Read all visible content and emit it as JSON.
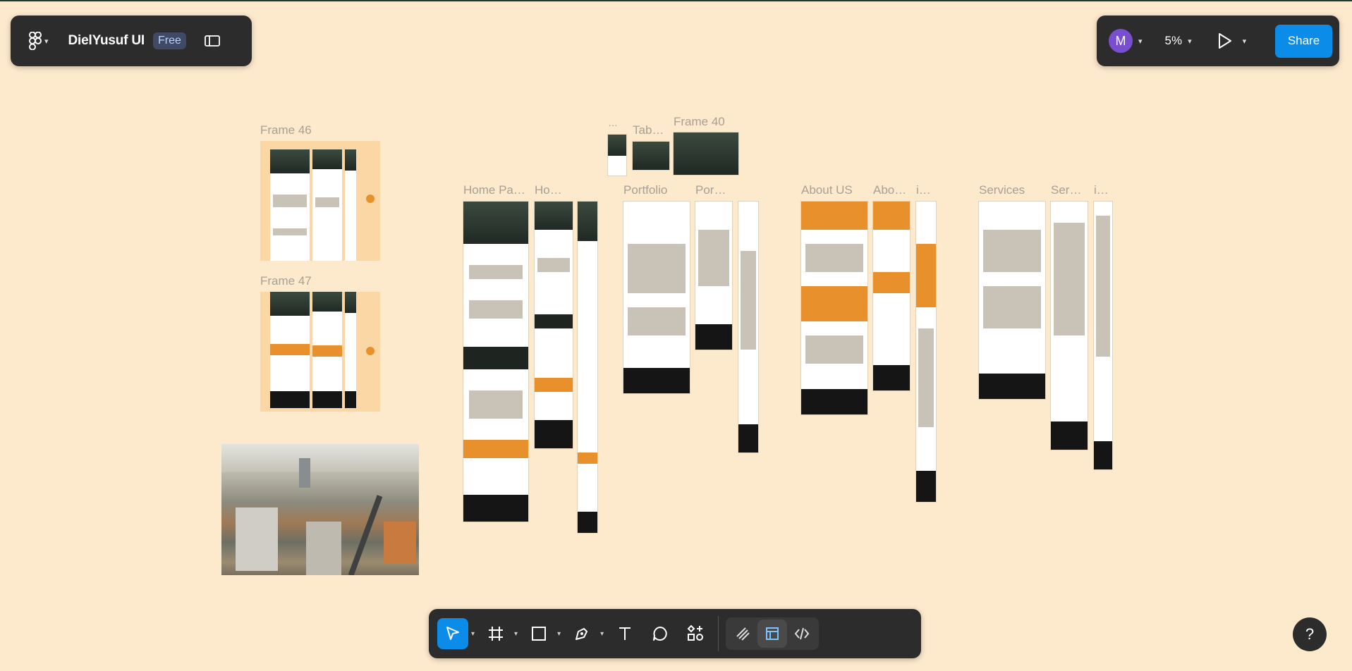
{
  "header": {
    "file_title": "DielYusuf UI",
    "plan_badge": "Free",
    "user_initial": "M",
    "zoom": "5%",
    "share_label": "Share"
  },
  "canvas": {
    "frames": [
      {
        "label": "Frame 46"
      },
      {
        "label": "Frame 47"
      },
      {
        "label": "…"
      },
      {
        "label": "Tab…"
      },
      {
        "label": "Frame 40"
      },
      {
        "label": "Home Pa…"
      },
      {
        "label": "Ho…"
      },
      {
        "label": "Portfolio"
      },
      {
        "label": "Por…"
      },
      {
        "label": "About US"
      },
      {
        "label": "Abo…"
      },
      {
        "label": "i…"
      },
      {
        "label": "Services"
      },
      {
        "label": "Ser…"
      },
      {
        "label": "i…"
      }
    ]
  },
  "toolbar": {
    "tools": [
      "move-tool",
      "frame-tool",
      "shape-tool",
      "pen-tool",
      "text-tool",
      "comment-tool",
      "actions-tool",
      "draw-mode",
      "design-mode",
      "dev-mode"
    ],
    "active_tool": "move-tool"
  },
  "help_label": "?",
  "colors": {
    "accent": "#0c8ce9",
    "canvas": "#fde9cc",
    "panel": "#2c2c2c",
    "brand_orange": "#e8912c"
  }
}
